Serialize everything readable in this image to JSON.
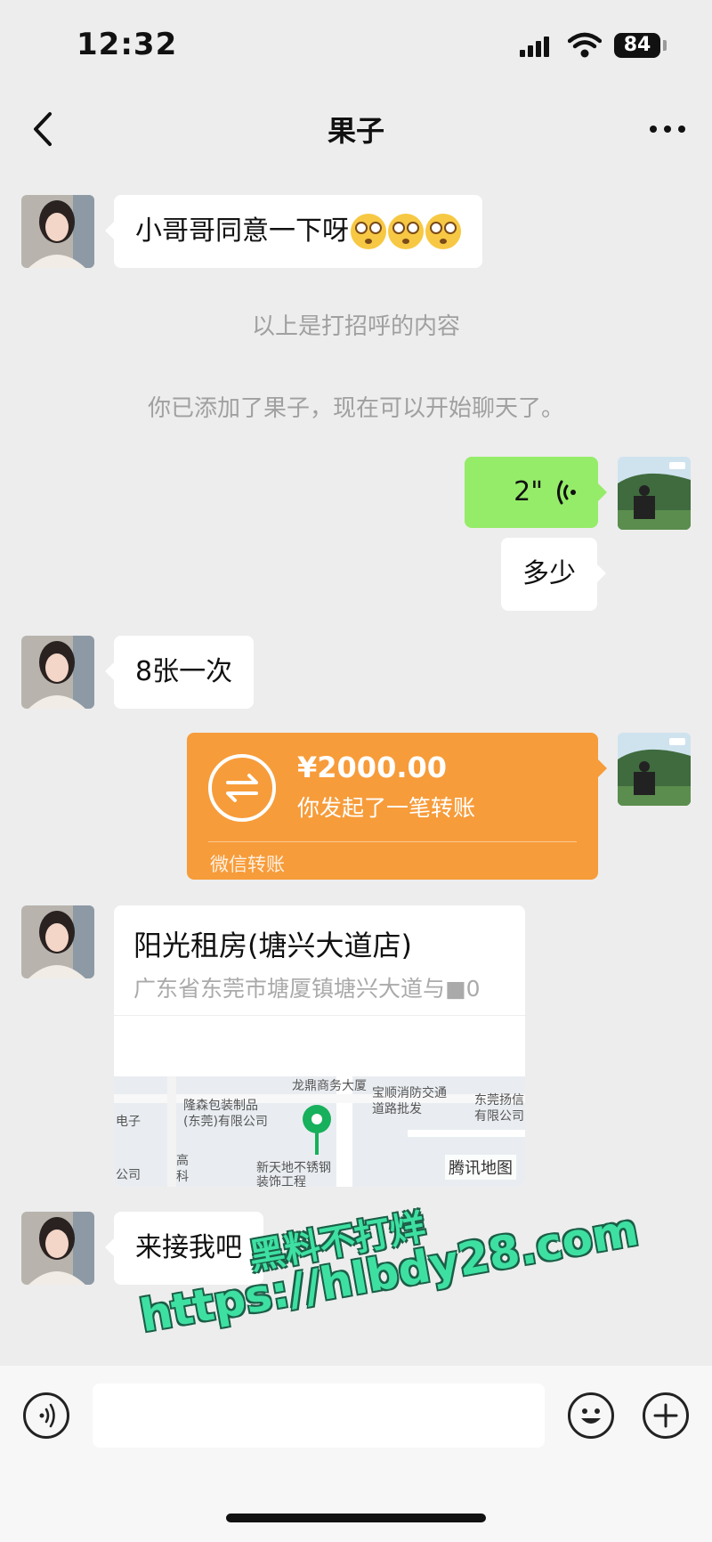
{
  "status_bar": {
    "time": "12:32",
    "battery": "84"
  },
  "header": {
    "title": "果子",
    "back_icon": "chevron-left-icon",
    "more_icon": "more-horizontal-icon"
  },
  "messages": [
    {
      "side": "left",
      "type": "text",
      "text": "小哥哥同意一下呀",
      "emoji": [
        "flushed-face",
        "flushed-face",
        "flushed-face"
      ]
    },
    {
      "type": "system",
      "text": "以上是打招呼的内容"
    },
    {
      "type": "system",
      "text": "你已添加了果子，现在可以开始聊天了。"
    },
    {
      "side": "right",
      "type": "voice",
      "duration": "2\""
    },
    {
      "side": "right",
      "type": "text",
      "text": "多少"
    },
    {
      "side": "left",
      "type": "text",
      "text": "8张一次"
    },
    {
      "side": "right",
      "type": "transfer",
      "amount": "¥2000.00",
      "description": "你发起了一笔转账",
      "footer": "微信转账"
    },
    {
      "side": "left",
      "type": "location",
      "name": "阳光租房(塘兴大道店)",
      "address": "广东省东莞市塘厦镇塘兴大道与■0",
      "map_labels": [
        "龙鼎商务大厦",
        "宝顺消防交通",
        "道路批发",
        "东莞扬信",
        "有限公司",
        "隆森包装制品",
        "(东莞)有限公司",
        "电子",
        "公司",
        "新天地不锈钢",
        "装饰工程",
        "高",
        "科"
      ],
      "map_provider": "腾讯地图"
    },
    {
      "side": "left",
      "type": "text",
      "text": "来接我吧"
    }
  ],
  "watermark": {
    "line1": "黑料不打烊",
    "line2": "https://hlbdy28.com"
  },
  "input_bar": {
    "voice_icon": "voice-icon",
    "emoji_icon": "smile-icon",
    "plus_icon": "plus-circle-icon",
    "placeholder": ""
  }
}
